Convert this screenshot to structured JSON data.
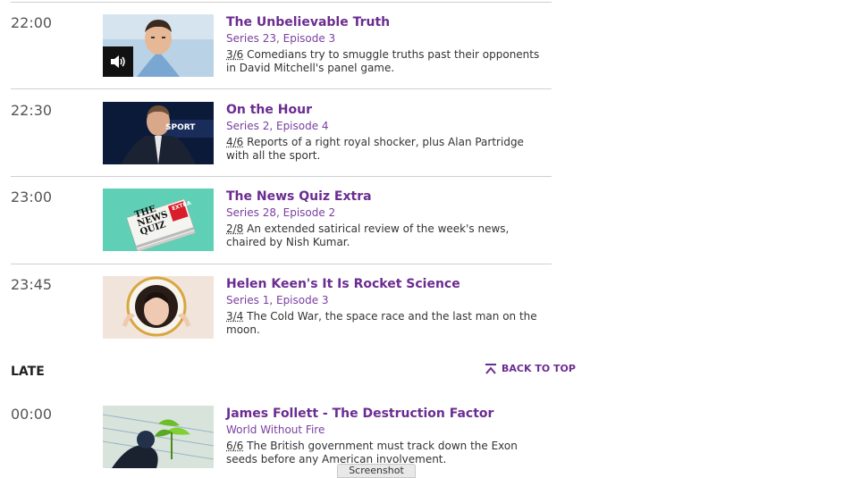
{
  "programmes": [
    {
      "time": "22:00",
      "title": "The Unbelievable Truth",
      "subtitle": "Series 23, Episode 3",
      "episode": "3/6",
      "synopsis": "Comedians try to smuggle truths past their opponents in David Mitchell's panel game.",
      "has_audio_badge": true
    },
    {
      "time": "22:30",
      "title": "On the Hour",
      "subtitle": "Series 2, Episode 4",
      "episode": "4/6",
      "synopsis": "Reports of a right royal shocker, plus Alan Partridge with all the sport.",
      "thumb_text": "SPORT"
    },
    {
      "time": "23:00",
      "title": "The News Quiz Extra",
      "subtitle": "Series 28, Episode 2",
      "episode": "2/8",
      "synopsis": "An extended satirical review of the week's news, chaired by Nish Kumar.",
      "thumb_text": "THE NEWS QUIZ",
      "thumb_badge": "EXTRA"
    },
    {
      "time": "23:45",
      "title": "Helen Keen's It Is Rocket Science",
      "subtitle": "Series 1, Episode 3",
      "episode": "3/4",
      "synopsis": "The Cold War, the space race and the last man on the moon."
    }
  ],
  "late": {
    "heading": "LATE",
    "back_to_top": "BACK TO TOP"
  },
  "late_programmes": [
    {
      "time": "00:00",
      "title": "James Follett - The Destruction Factor",
      "subtitle": "World Without Fire",
      "episode": "6/6",
      "synopsis": "The British government must track down the Exon seeds before any American involvement."
    }
  ],
  "screenshot_tab": "Screenshot",
  "colors": {
    "link": "#6b2c91",
    "divider": "#cfcfcf"
  }
}
